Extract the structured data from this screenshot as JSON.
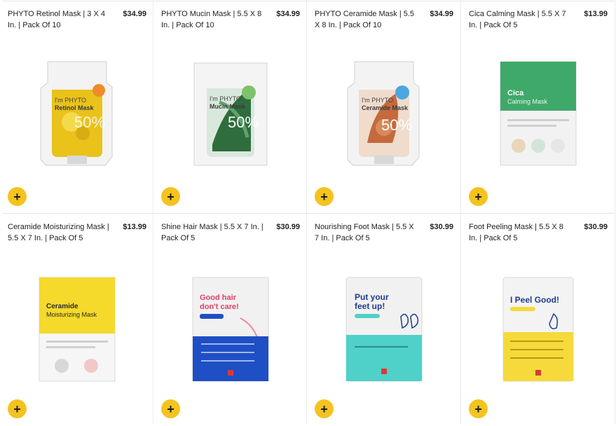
{
  "products": [
    {
      "title": "PHYTO Retinol Mask | 3 X 4 In. | Pack Of 10",
      "price": "$34.99",
      "pack_text": "Retinol Mask",
      "icon": "phyto-retinol-mask-image",
      "accent": "#e9c21a"
    },
    {
      "title": "PHYTO Mucin Mask | 5.5 X 8 In. | Pack Of 10",
      "price": "$34.99",
      "pack_text": "Mucin Mask",
      "icon": "phyto-mucin-mask-image",
      "accent": "#2f6d3d"
    },
    {
      "title": "PHYTO Ceramide Mask | 5.5 X 8 In. | Pack Of 10",
      "price": "$34.99",
      "pack_text": "Ceramide Mask",
      "icon": "phyto-ceramide-mask-image",
      "accent": "#c46a3e"
    },
    {
      "title": "Cica Calming Mask | 5.5 X 7 In. | Pack Of 5",
      "price": "$13.99",
      "pack_text": "Cica",
      "pack_text2": "Calming Mask",
      "icon": "cica-calming-mask-image",
      "accent": "#3fa96a"
    },
    {
      "title": "Ceramide Moisturizing Mask | 5.5 X 7 In. | Pack Of 5",
      "price": "$13.99",
      "pack_text": "Ceramide",
      "pack_text2": "Moisturizing Mask",
      "icon": "ceramide-moisturizing-mask-image",
      "accent": "#f5d92b"
    },
    {
      "title": "Shine Hair Mask | 5.5 X 7 In. | Pack Of 5",
      "price": "$30.99",
      "pack_text": "Good hair",
      "pack_text2": "don't care!",
      "icon": "shine-hair-mask-image",
      "accent": "#1f4fc4"
    },
    {
      "title": "Nourishing Foot Mask | 5.5 X 7 In. | Pack Of 5",
      "price": "$30.99",
      "pack_text": "Put your",
      "pack_text2": "feet up!",
      "icon": "nourishing-foot-mask-image",
      "accent": "#4fd0c9"
    },
    {
      "title": "Foot Peeling Mask | 5.5 X 8 In. | Pack Of 5",
      "price": "$30.99",
      "pack_text": "I Peel Good!",
      "icon": "foot-peeling-mask-image",
      "accent": "#f6d93a"
    }
  ],
  "add_label": "+"
}
